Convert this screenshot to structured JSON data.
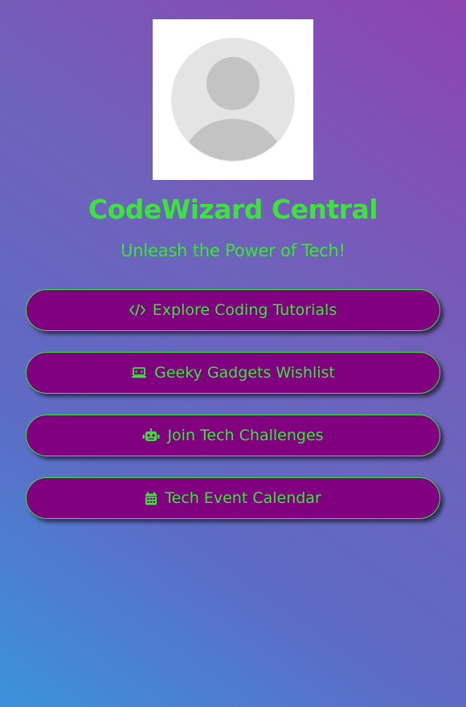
{
  "profile": {
    "name": "CodeWizard Central",
    "tagline": "Unleash the Power of Tech!",
    "avatar_icon": "default-user-avatar-icon"
  },
  "links": [
    {
      "label": "Explore Coding Tutorials",
      "icon": "code-icon"
    },
    {
      "label": "Geeky Gadgets Wishlist",
      "icon": "laptop-icon"
    },
    {
      "label": "Join Tech Challenges",
      "icon": "robot-icon"
    },
    {
      "label": "Tech Event Calendar",
      "icon": "calendar-icon"
    }
  ],
  "colors": {
    "accent": "#3be43a",
    "button_bg": "#800080",
    "gradient_top_right": "#8e44b0",
    "gradient_bottom_left": "#3a93dc"
  }
}
